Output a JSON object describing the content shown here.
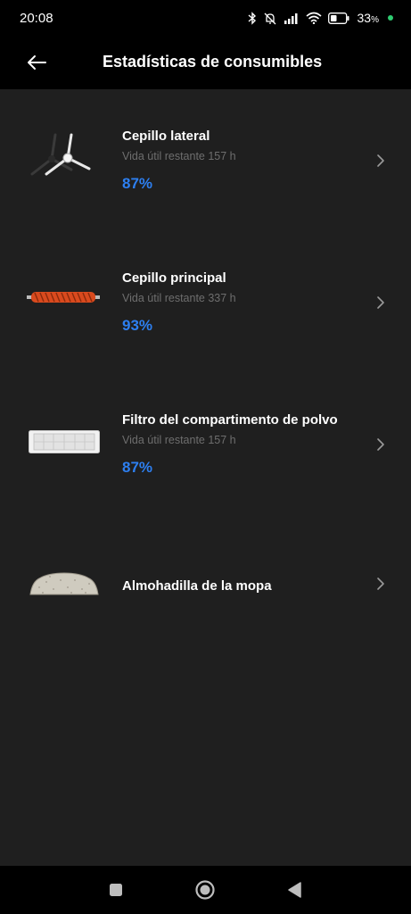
{
  "status_bar": {
    "time": "20:08",
    "battery_percent": "33",
    "battery_unit": "%",
    "charging_color": "#2ecc71"
  },
  "header": {
    "title": "Estadísticas de consumibles",
    "back_icon": "arrow-left-icon"
  },
  "consumables": [
    {
      "name": "Cepillo lateral",
      "subtitle": "Vida útil restante 157 h",
      "percent": "87%",
      "icon": "side-brush-image"
    },
    {
      "name": "Cepillo principal",
      "subtitle": "Vida útil restante 337 h",
      "percent": "93%",
      "icon": "main-brush-image"
    },
    {
      "name": "Filtro del compartimento de polvo",
      "subtitle": "Vida útil restante 157 h",
      "percent": "87%",
      "icon": "filter-image"
    },
    {
      "name": "Almohadilla de la mopa",
      "icon": "mop-pad-image"
    }
  ],
  "colors": {
    "accent": "#2d7ff0",
    "background": "#1f1f1f",
    "bar_background": "#000000"
  },
  "nav_bar": {
    "recents_icon": "square-icon",
    "home_icon": "circle-home-icon",
    "back_icon": "triangle-back-icon"
  }
}
